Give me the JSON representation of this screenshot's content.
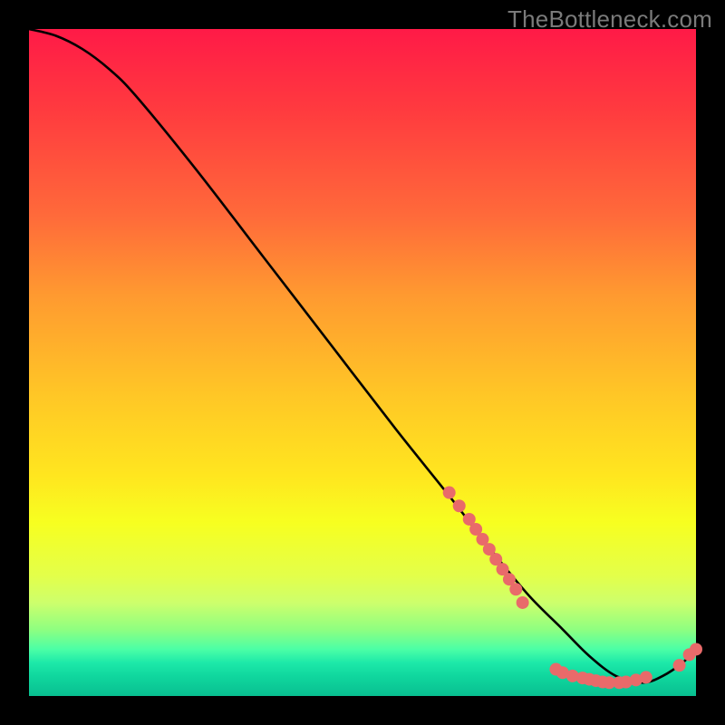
{
  "watermark": "TheBottleneck.com",
  "chart_data": {
    "type": "line",
    "title": "",
    "xlabel": "",
    "ylabel": "",
    "xlim": [
      0,
      100
    ],
    "ylim": [
      0,
      100
    ],
    "grid": false,
    "legend": false,
    "series": [
      {
        "name": "curve",
        "x": [
          0,
          4,
          8,
          12,
          16,
          25,
          35,
          45,
          55,
          63,
          70,
          75,
          80,
          84,
          88,
          92,
          95,
          98,
          100
        ],
        "y": [
          100,
          99,
          97,
          94,
          90,
          79,
          66,
          53,
          40,
          30,
          21,
          15,
          10,
          6,
          3,
          2,
          3,
          5,
          7
        ]
      }
    ],
    "markers": [
      {
        "x": 63.0,
        "y": 30.5
      },
      {
        "x": 64.5,
        "y": 28.5
      },
      {
        "x": 66.0,
        "y": 26.5
      },
      {
        "x": 67.0,
        "y": 25.0
      },
      {
        "x": 68.0,
        "y": 23.5
      },
      {
        "x": 69.0,
        "y": 22.0
      },
      {
        "x": 70.0,
        "y": 20.5
      },
      {
        "x": 71.0,
        "y": 19.0
      },
      {
        "x": 72.0,
        "y": 17.5
      },
      {
        "x": 73.0,
        "y": 16.0
      },
      {
        "x": 74.0,
        "y": 14.0
      },
      {
        "x": 79.0,
        "y": 4.0
      },
      {
        "x": 80.0,
        "y": 3.5
      },
      {
        "x": 81.5,
        "y": 3.0
      },
      {
        "x": 83.0,
        "y": 2.7
      },
      {
        "x": 84.0,
        "y": 2.5
      },
      {
        "x": 85.0,
        "y": 2.3
      },
      {
        "x": 86.0,
        "y": 2.1
      },
      {
        "x": 87.0,
        "y": 2.0
      },
      {
        "x": 88.5,
        "y": 2.0
      },
      {
        "x": 89.5,
        "y": 2.1
      },
      {
        "x": 91.0,
        "y": 2.4
      },
      {
        "x": 92.5,
        "y": 2.8
      },
      {
        "x": 97.5,
        "y": 4.6
      },
      {
        "x": 99.0,
        "y": 6.2
      },
      {
        "x": 100.0,
        "y": 7.0
      }
    ],
    "colors": {
      "curve": "#000000",
      "marker_fill": "#e96a6a",
      "marker_stroke": "#b24a4a"
    }
  }
}
